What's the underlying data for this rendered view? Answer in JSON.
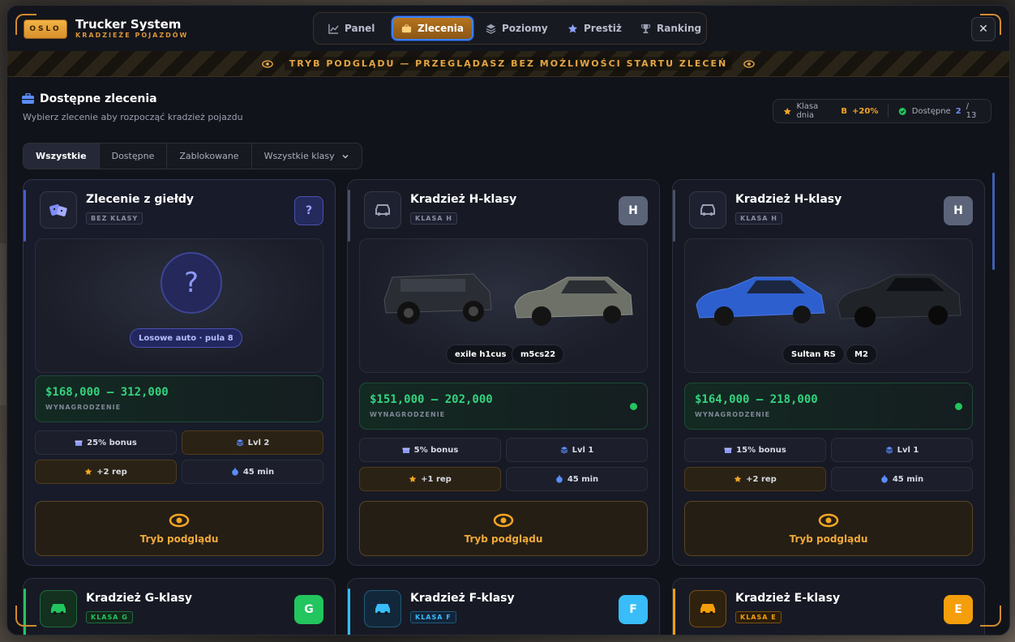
{
  "header": {
    "logo_badge": "OSLO",
    "title": "Trucker System",
    "subtitle": "KRADZIEŻE POJAZDÓW",
    "close_glyph": "✕"
  },
  "nav": {
    "tabs": [
      {
        "label": "Panel",
        "icon": "chart-line-icon"
      },
      {
        "label": "Zlecenia",
        "icon": "briefcase-icon",
        "active": true
      },
      {
        "label": "Poziomy",
        "icon": "layers-icon"
      },
      {
        "label": "Prestiż",
        "icon": "star-icon"
      },
      {
        "label": "Ranking",
        "icon": "trophy-icon"
      }
    ]
  },
  "banner": {
    "text": "TRYB PODGLĄDU — PRZEGLĄDASZ BEZ MOŻLIWOŚCI STARTU ZLECEŃ"
  },
  "section": {
    "title": "Dostępne zlecenia",
    "subtitle": "Wybierz zlecenie aby rozpocząć kradzież pojazdu"
  },
  "info": {
    "class_label": "Klasa dnia",
    "class_value": "B",
    "class_bonus": "+20%",
    "available_label": "Dostępne",
    "available_count": "2",
    "available_total": "/ 13"
  },
  "filters": [
    "Wszystkie",
    "Dostępne",
    "Zablokowane",
    "Wszystkie klasy"
  ],
  "cards": [
    {
      "title": "Zlecenie z giełdy",
      "class_tag": "BEZ KLASY",
      "grade": "?",
      "mystery_glyph": "?",
      "pool_label": "Losowe auto · pula 8",
      "reward": "$168,000 – 312,000",
      "reward_label": "WYNAGRODZENIE",
      "bonus": "25% bonus",
      "level": "Lvl 2",
      "rep": "+2 rep",
      "time": "45 min",
      "cta": "Tryb podglądu"
    },
    {
      "title": "Kradzież H-klasy",
      "class_tag": "KLASA H",
      "grade": "H",
      "cars": [
        "exile h1cus",
        "m5cs22"
      ],
      "reward": "$151,000 – 202,000",
      "reward_label": "WYNAGRODZENIE",
      "bonus": "5% bonus",
      "level": "Lvl 1",
      "rep": "+1 rep",
      "time": "45 min",
      "cta": "Tryb podglądu"
    },
    {
      "title": "Kradzież H-klasy",
      "class_tag": "KLASA H",
      "grade": "H",
      "cars": [
        "Sultan RS",
        "M2"
      ],
      "reward": "$164,000 – 218,000",
      "reward_label": "WYNAGRODZENIE",
      "bonus": "15% bonus",
      "level": "Lvl 1",
      "rep": "+2 rep",
      "time": "45 min",
      "cta": "Tryb podglądu"
    },
    {
      "title": "Kradzież G-klasy",
      "class_tag": "KLASA G",
      "grade": "G",
      "accent": "#22c55e"
    },
    {
      "title": "Kradzież F-klasy",
      "class_tag": "KLASA F",
      "grade": "F",
      "accent": "#38bdf8"
    },
    {
      "title": "Kradzież E-klasy",
      "class_tag": "KLASA E",
      "grade": "E",
      "accent": "#f59e0b"
    }
  ],
  "colors": {
    "accent": "#d9963a",
    "reward_green": "#34d27f",
    "active_outline": "#3b82f6"
  }
}
